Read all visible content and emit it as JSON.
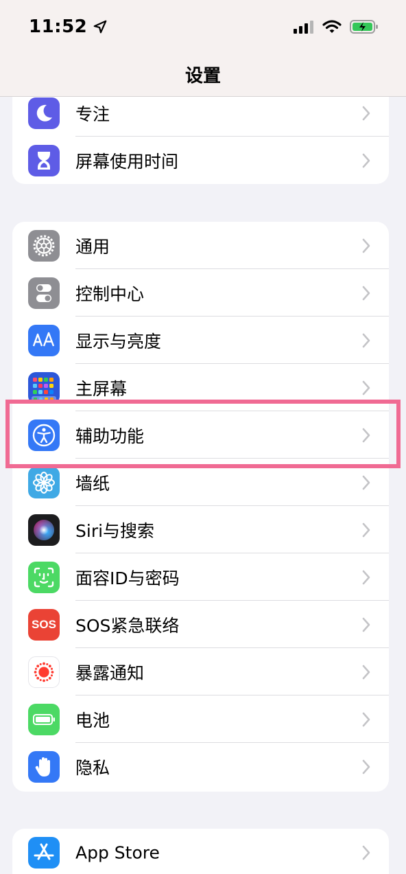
{
  "status_bar": {
    "time": "11:52",
    "icons": [
      "location-arrow-icon",
      "cellular-signal-icon",
      "wifi-icon",
      "battery-charging-icon"
    ]
  },
  "nav": {
    "title": "设置"
  },
  "groups": [
    {
      "items": [
        {
          "label": "专注",
          "icon": "moon-icon",
          "color": "#5e5ce6"
        },
        {
          "label": "屏幕使用时间",
          "icon": "hourglass-icon",
          "color": "#5e5ce6"
        }
      ]
    },
    {
      "items": [
        {
          "label": "通用",
          "icon": "gear-icon",
          "color": "#8e8e93"
        },
        {
          "label": "控制中心",
          "icon": "toggles-icon",
          "color": "#8e8e93"
        },
        {
          "label": "显示与亮度",
          "icon": "text-size-icon",
          "color": "#3478f6"
        },
        {
          "label": "主屏幕",
          "icon": "home-screen-grid-icon",
          "color": "#2c57d9"
        },
        {
          "label": "辅助功能",
          "icon": "accessibility-icon",
          "color": "#3478f6"
        },
        {
          "label": "墙纸",
          "icon": "flower-icon",
          "color": "#3fa9e5"
        },
        {
          "label": "Siri与搜索",
          "icon": "siri-icon",
          "color": "#1c1c1e"
        },
        {
          "label": "面容ID与密码",
          "icon": "face-id-icon",
          "color": "#4cd964"
        },
        {
          "label": "SOS紧急联络",
          "icon": "sos-icon",
          "color": "#ea4335",
          "icon_text": "SOS"
        },
        {
          "label": "暴露通知",
          "icon": "exposure-notification-icon",
          "color": "#ff3b30"
        },
        {
          "label": "电池",
          "icon": "battery-icon",
          "color": "#4cd964"
        },
        {
          "label": "隐私",
          "icon": "hand-icon",
          "color": "#3478f6"
        }
      ]
    },
    {
      "items": [
        {
          "label": "App Store",
          "icon": "app-store-icon",
          "color": "#1f8ff5"
        }
      ]
    }
  ],
  "highlight": {
    "color": "#f06a93",
    "target": "辅助功能"
  }
}
